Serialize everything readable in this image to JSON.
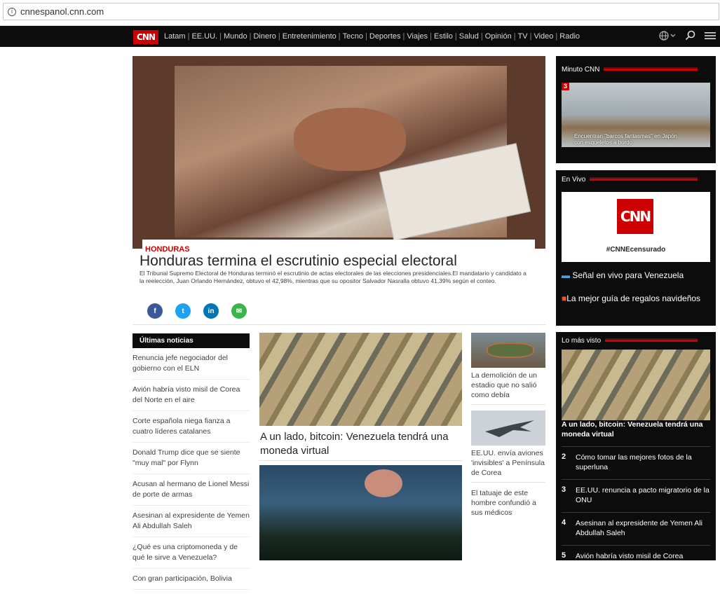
{
  "browser": {
    "url": "cnnespanol.cnn.com"
  },
  "nav": {
    "logo": "CNN",
    "links": [
      "Latam",
      "EE.UU.",
      "Mundo",
      "Dinero",
      "Entretenimiento",
      "Tecno",
      "Deportes",
      "Viajes",
      "Estilo",
      "Salud",
      "Opinión",
      "TV",
      "Video",
      "Radio"
    ]
  },
  "hero": {
    "section": "HONDURAS",
    "headline": "Honduras termina el escrutinio especial electoral",
    "summary": "El Tribunal Supremo Electoral de Honduras terminó el escrutinio de actas electorales de las elecciones presidenciales.El mandatario y candidato a la reelección, Juan Orlando Hernández, obtuvo el 42,98%, mientras que su opositor Salvador Nasralla obtuvo 41,39% según el conteo."
  },
  "share": [
    {
      "icon": "facebook-icon",
      "label": "f",
      "color": "#3b5998"
    },
    {
      "icon": "twitter-icon",
      "label": "t",
      "color": "#1da1f2"
    },
    {
      "icon": "linkedin-icon",
      "label": "in",
      "color": "#0077b5"
    },
    {
      "icon": "email-icon",
      "label": "✉",
      "color": "#3ab54a"
    }
  ],
  "latest": {
    "title": "Últimas noticias",
    "items": [
      "Renuncia jefe negociador del gobierno con el ELN",
      "Avión habría visto misil de Corea del Norte en el aire",
      "Corte española niega fianza a cuatro líderes catalanes",
      "Donald Trump dice que se siente \"muy mal\" por Flynn",
      "Acusan al hermano de Lionel Messi de porte de armas",
      "Asesinan al expresidente de Yemen Ali Abdullah Saleh",
      "¿Qué es una criptomoneda y de qué le sirve a Venezuela?",
      "Con gran participación, Bolivia"
    ]
  },
  "main_story": {
    "title": "A un lado, bitcoin: Venezuela tendrá una moneda virtual"
  },
  "side_stories": [
    "La demolición de un estadio que no salió como debía",
    "EE.UU. envía aviones 'invisibles' a Península de Corea",
    "El tatuaje de este hombre confundió a sus médicos"
  ],
  "minuto": {
    "title": "Minuto CNN",
    "badge": "3",
    "caption": "Encuentran \"barcos fantasmas\" en Japón con esqueletos a bordo"
  },
  "envivo": {
    "title": "En Vivo",
    "tag": "#CNNEcensurado",
    "link1": "Señal en vivo para Venezuela",
    "link2": "La mejor guía de regalos navideños"
  },
  "masvisto": {
    "title": "Lo más visto",
    "lead": "A un lado, bitcoin: Venezuela tendrá una moneda virtual",
    "items": [
      {
        "num": "2",
        "text": "Cómo tomar las mejores fotos de la superluna"
      },
      {
        "num": "3",
        "text": "EE.UU. renuncia a pacto migratorio de la ONU"
      },
      {
        "num": "4",
        "text": "Asesinan al expresidente de Yemen Ali Abdullah Saleh"
      },
      {
        "num": "5",
        "text": "Avión habría visto misil de Corea"
      }
    ]
  }
}
